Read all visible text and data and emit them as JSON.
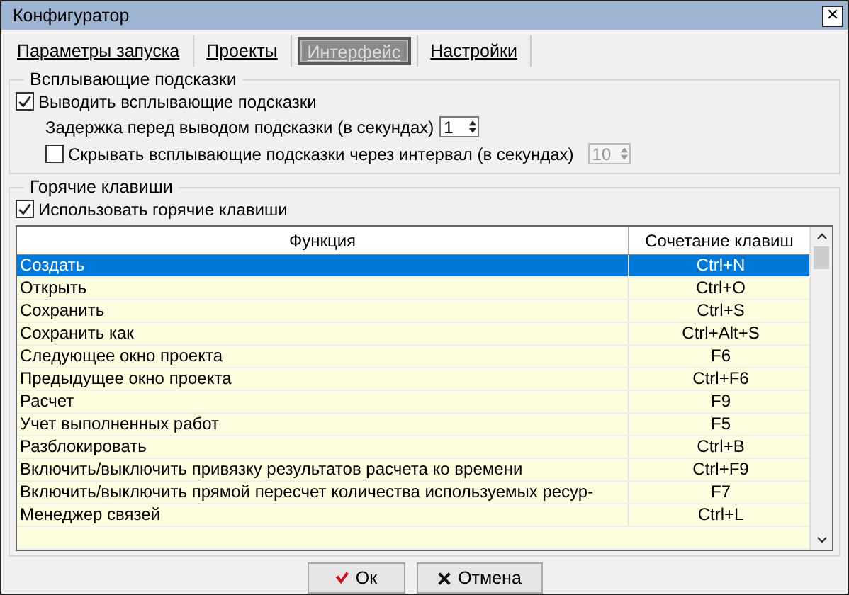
{
  "window": {
    "title": "Конфигуратор",
    "close": "✕"
  },
  "tabs": [
    {
      "label": "Параметры запуска",
      "selected": false
    },
    {
      "label": "Проекты",
      "selected": false
    },
    {
      "label": "Интерфейс",
      "selected": true
    },
    {
      "label": "Настройки",
      "selected": false
    }
  ],
  "tooltips": {
    "title": "Всплывающие подсказки",
    "show": {
      "label": "Выводить всплывающие подсказки",
      "checked": true
    },
    "delay": {
      "label": "Задержка перед выводом подсказки (в секундах)",
      "value": "1",
      "disabled": false
    },
    "hide": {
      "label": "Скрывать всплывающие подсказки через интервал (в секундах)",
      "checked": false
    },
    "interval": {
      "value": "10",
      "disabled": true
    }
  },
  "hotkeys": {
    "title": "Горячие клавиши",
    "use": {
      "label": "Использовать горячие клавиши",
      "checked": true
    },
    "table": {
      "columns": [
        "Функция",
        "Сочетание клавиш"
      ],
      "rows": [
        {
          "function": "Создать",
          "keys": "Ctrl+N",
          "selected": true
        },
        {
          "function": "Открыть",
          "keys": "Ctrl+O",
          "selected": false
        },
        {
          "function": "Сохранить",
          "keys": "Ctrl+S",
          "selected": false
        },
        {
          "function": "Сохранить как",
          "keys": "Ctrl+Alt+S",
          "selected": false
        },
        {
          "function": "Следующее окно проекта",
          "keys": "F6",
          "selected": false
        },
        {
          "function": "Предыдущее окно проекта",
          "keys": "Ctrl+F6",
          "selected": false
        },
        {
          "function": "Расчет",
          "keys": "F9",
          "selected": false
        },
        {
          "function": "Учет выполненных работ",
          "keys": "F5",
          "selected": false
        },
        {
          "function": "Разблокировать",
          "keys": "Ctrl+B",
          "selected": false
        },
        {
          "function": "Включить/выключить привязку результатов расчета ко времени",
          "keys": "Ctrl+F9",
          "selected": false
        },
        {
          "function": "Включить/выключить прямой пересчет количества используемых ресур-",
          "keys": "F7",
          "selected": false
        },
        {
          "function": "Менеджер связей",
          "keys": "Ctrl+L",
          "selected": false
        }
      ]
    }
  },
  "buttons": [
    {
      "kind": "ok",
      "label": "Ок"
    },
    {
      "kind": "cancel",
      "label": "Отмена"
    }
  ]
}
